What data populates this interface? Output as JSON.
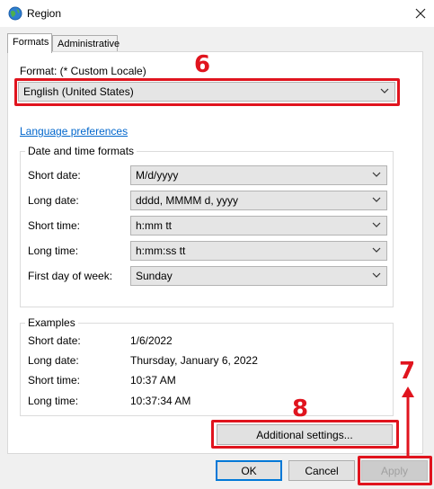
{
  "window": {
    "title": "Region"
  },
  "tabs": [
    {
      "label": "Formats"
    },
    {
      "label": "Administrative"
    }
  ],
  "format": {
    "label": "Format: (* Custom Locale)",
    "value": "English (United States)"
  },
  "language_link": "Language preferences",
  "datetime": {
    "title": "Date and time formats",
    "rows": [
      {
        "label": "Short date:",
        "value": "M/d/yyyy"
      },
      {
        "label": "Long date:",
        "value": "dddd, MMMM d, yyyy"
      },
      {
        "label": "Short time:",
        "value": "h:mm tt"
      },
      {
        "label": "Long time:",
        "value": "h:mm:ss tt"
      },
      {
        "label": "First day of week:",
        "value": "Sunday"
      }
    ]
  },
  "examples": {
    "title": "Examples",
    "rows": [
      {
        "label": "Short date:",
        "value": "1/6/2022"
      },
      {
        "label": "Long date:",
        "value": "Thursday, January 6, 2022"
      },
      {
        "label": "Short time:",
        "value": "10:37 AM"
      },
      {
        "label": "Long time:",
        "value": "10:37:34 AM"
      }
    ]
  },
  "buttons": {
    "additional": "Additional settings...",
    "ok": "OK",
    "cancel": "Cancel",
    "apply": "Apply"
  },
  "annotations": {
    "six": "6",
    "seven": "7",
    "eight": "8",
    "color": "#e0141e"
  },
  "icons": {
    "app": "region-globe-icon",
    "close": "close-icon",
    "dropdown": "chevron-down-icon"
  }
}
